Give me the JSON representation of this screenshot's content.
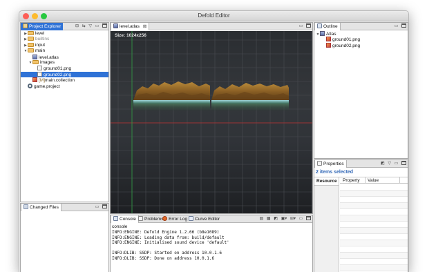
{
  "window": {
    "title": "Defold Editor"
  },
  "project_explorer": {
    "tab_label": "Project Explorer",
    "items": [
      {
        "label": "level",
        "depth": 0,
        "icon": "folder-icon",
        "expanded": false,
        "dim": false
      },
      {
        "label": "builtins",
        "depth": 0,
        "icon": "folder-icon",
        "expanded": false,
        "dim": true
      },
      {
        "label": "input",
        "depth": 0,
        "icon": "folder-icon",
        "expanded": false,
        "dim": false
      },
      {
        "label": "main",
        "depth": 0,
        "icon": "folder-icon",
        "expanded": true,
        "dim": false
      },
      {
        "label": "level.atlas",
        "depth": 1,
        "icon": "atlas-icon",
        "expanded": null,
        "dim": false
      },
      {
        "label": "images",
        "depth": 1,
        "icon": "folder-icon",
        "expanded": true,
        "dim": false
      },
      {
        "label": "ground01.png",
        "depth": 2,
        "icon": "file-icon",
        "expanded": null,
        "dim": false
      },
      {
        "label": "ground02.png",
        "depth": 2,
        "icon": "file-icon",
        "expanded": null,
        "dim": false,
        "selected": true
      },
      {
        "label": "main.collection",
        "depth": 1,
        "icon": "collection-icon",
        "expanded": null,
        "dim": false,
        "prefix": "[M]"
      },
      {
        "label": "game.project",
        "depth": 0,
        "icon": "gear-icon",
        "expanded": null,
        "dim": false
      }
    ]
  },
  "changed_files": {
    "tab_label": "Changed Files"
  },
  "editor": {
    "tab_label": "level.atlas",
    "size_label": "Size: 1024x256"
  },
  "console": {
    "tabs": [
      "Console",
      "Problems",
      "Error Log",
      "Curve Editor"
    ],
    "header": "console",
    "lines": [
      "INFO:ENGINE: Defold Engine 1.2.66 (b8e1089)",
      "INFO:ENGINE: Loading data from: build/default",
      "INFO:ENGINE: Initialised sound device 'default'",
      "",
      "INFO:DLIB: SSDP: Started on address 10.0.1.6",
      "INFO:DLIB: SSDP: Done on address 10.0.1.6"
    ]
  },
  "outline": {
    "tab_label": "Outline",
    "root": "Atlas",
    "children": [
      "ground01.png",
      "ground02.png"
    ]
  },
  "properties": {
    "tab_label": "Properties",
    "summary": "2 items selected",
    "category": "Resource",
    "col_property": "Property",
    "col_value": "Value"
  },
  "colors": {
    "selection": "#2f72d6",
    "canvas_bg": "#25272a",
    "grid": "#4a4d52",
    "x_axis": "#c03030",
    "y_axis": "#2fa043",
    "traffic_red": "#fd5f57",
    "traffic_yellow": "#fdbb2e",
    "traffic_green": "#28c840"
  }
}
